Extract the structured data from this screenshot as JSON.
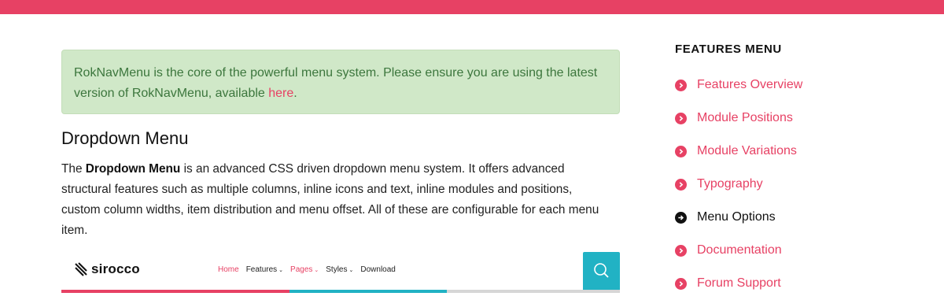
{
  "colors": {
    "accent": "#e74164",
    "notice_bg": "#d0e8c8",
    "notice_text": "#3c763d",
    "teal": "#21b2c4"
  },
  "notice": {
    "text": "RokNavMenu is the core of the powerful menu system. Please ensure you are using the latest version of RokNavMenu, available ",
    "link": "here",
    "end": "."
  },
  "section": {
    "title": "Dropdown Menu",
    "intro_pre": "The ",
    "intro_bold": "Dropdown Menu",
    "intro_post": " is an advanced CSS driven dropdown menu system. It offers advanced structural features such as multiple columns, inline icons and text, inline modules and positions, custom column widths, item distribution and menu offset. All of these are configurable for each menu item."
  },
  "preview": {
    "brand": "sirocco",
    "nav": [
      {
        "label": "Home",
        "active": true,
        "dropdown": false
      },
      {
        "label": "Features",
        "active": false,
        "dropdown": true
      },
      {
        "label": "Pages",
        "active": true,
        "dropdown": true
      },
      {
        "label": "Styles",
        "active": false,
        "dropdown": true
      },
      {
        "label": "Download",
        "active": false,
        "dropdown": false
      }
    ],
    "search_icon": "search-icon"
  },
  "sidebar": {
    "title": "FEATURES MENU",
    "items": [
      {
        "label": "Features Overview",
        "current": false,
        "icon": "chevron-right-circle-icon"
      },
      {
        "label": "Module Positions",
        "current": false,
        "icon": "chevron-right-circle-icon"
      },
      {
        "label": "Module Variations",
        "current": false,
        "icon": "chevron-right-circle-icon"
      },
      {
        "label": "Typography",
        "current": false,
        "icon": "chevron-right-circle-icon"
      },
      {
        "label": "Menu Options",
        "current": true,
        "icon": "arrow-right-circle-icon"
      },
      {
        "label": "Documentation",
        "current": false,
        "icon": "chevron-right-circle-icon"
      },
      {
        "label": "Forum Support",
        "current": false,
        "icon": "chevron-right-circle-icon"
      }
    ]
  }
}
